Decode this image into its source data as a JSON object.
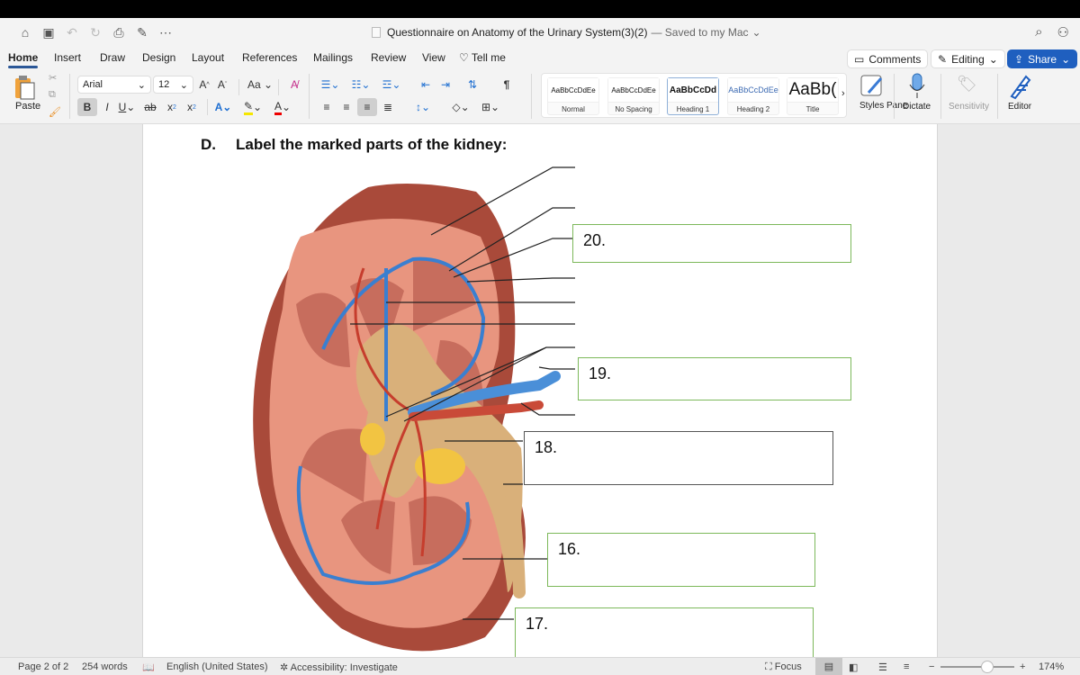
{
  "window": {
    "doc_title": "Questionnaire on Anatomy of the Urinary System(3)(2)",
    "saved_status": "— Saved to my Mac",
    "quick_access": [
      "home-icon",
      "save-icon",
      "undo-icon",
      "redo-icon",
      "print-icon",
      "save-as-icon",
      "more-icon"
    ],
    "more_label": "⋯"
  },
  "tabs": [
    {
      "label": "Home",
      "active": true
    },
    {
      "label": "Insert"
    },
    {
      "label": "Draw"
    },
    {
      "label": "Design"
    },
    {
      "label": "Layout"
    },
    {
      "label": "References"
    },
    {
      "label": "Mailings"
    },
    {
      "label": "Review"
    },
    {
      "label": "View"
    },
    {
      "label": "Tell me"
    }
  ],
  "header_buttons": {
    "comments": "Comments",
    "editing": "Editing",
    "share": "Share"
  },
  "ribbon": {
    "paste": "Paste",
    "font_name": "Arial",
    "font_size": "12",
    "change_case": "Aa",
    "styles": [
      {
        "preview": "AaBbCcDdEe",
        "name": "Normal"
      },
      {
        "preview": "AaBbCcDdEe",
        "name": "No Spacing"
      },
      {
        "preview": "AaBbCcDd",
        "name": "Heading 1",
        "selected": true
      },
      {
        "preview": "AaBbCcDdEe",
        "name": "Heading 2"
      },
      {
        "preview": "AaBb(",
        "name": "Title"
      }
    ],
    "styles_pane": "Styles Pane",
    "dictate": "Dictate",
    "sensitivity": "Sensitivity",
    "editor": "Editor"
  },
  "document": {
    "section_letter": "D.",
    "section_title": "Label the marked parts of the kidney:",
    "label_boxes": [
      {
        "num": "20.",
        "answer": ""
      },
      {
        "num": "19.",
        "answer": ""
      },
      {
        "num": "18.",
        "answer": ""
      },
      {
        "num": "16.",
        "answer": ""
      },
      {
        "num": "17.",
        "answer": ""
      }
    ],
    "image_alt": "Frontal section of kidney showing cortex, medulla, pyramids, renal artery, renal vein, renal pelvis and ureter"
  },
  "statusbar": {
    "page": "Page 2 of 2",
    "words": "254 words",
    "language": "English (United States)",
    "accessibility": "Accessibility: Investigate",
    "focus": "Focus",
    "zoom": "174%",
    "zoom_level_percent": 174
  }
}
